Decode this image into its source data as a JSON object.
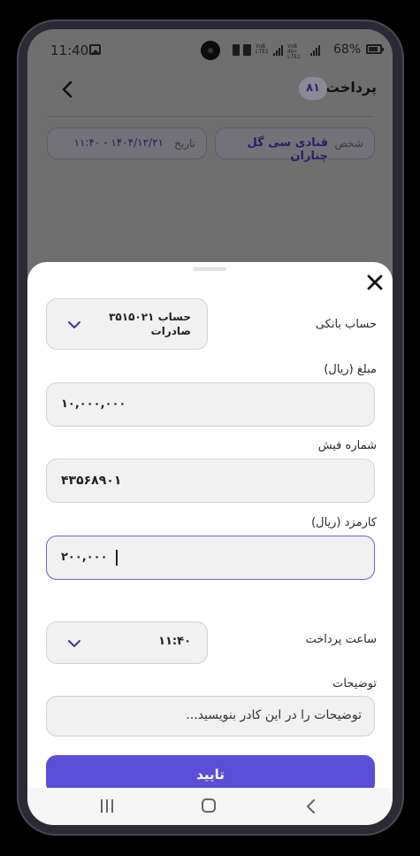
{
  "status_bar": {
    "time": "11:40",
    "network_1": "VoB LTE1",
    "network_2": "VoB 4G+ LTE2",
    "battery": "68%"
  },
  "header": {
    "title": "پرداخت",
    "count": "۸۱",
    "person_label": "شخص",
    "person_value": "قنادی سی گل چناران",
    "date_label": "تاریخ",
    "date_value": "۱۴۰۴/۱۲/۲۱ - ۱۱:۴۰"
  },
  "form": {
    "bank_account": {
      "label": "حساب بانکی",
      "value_line1": "حساب ۳۵۱۵۰۲۱",
      "value_line2": "صادرات"
    },
    "amount": {
      "label": "مبلغ (ریال)",
      "value": "۱۰,۰۰۰,۰۰۰"
    },
    "receipt_number": {
      "label": "شماره فیش",
      "value": "۴۳۵۶۸۹۰۱"
    },
    "fee": {
      "label": "کارمزد (ریال)",
      "value": "۲۰۰,۰۰۰"
    },
    "payment_time": {
      "label": "ساعت پرداخت",
      "value": "۱۱:۴۰"
    },
    "description": {
      "label": "توضیحات",
      "placeholder": "توضیحات را در این کادر بنویسید..."
    },
    "confirm_label": "تایید"
  },
  "colors": {
    "accent": "#5a4fd6",
    "overlay": "#6f6f70",
    "field_bg": "#f1f1f1"
  },
  "icons": [
    "gallery-icon",
    "back-arrow-icon",
    "close-icon",
    "chevron-down-icon",
    "nav-recents-icon",
    "nav-home-icon",
    "nav-back-icon"
  ]
}
